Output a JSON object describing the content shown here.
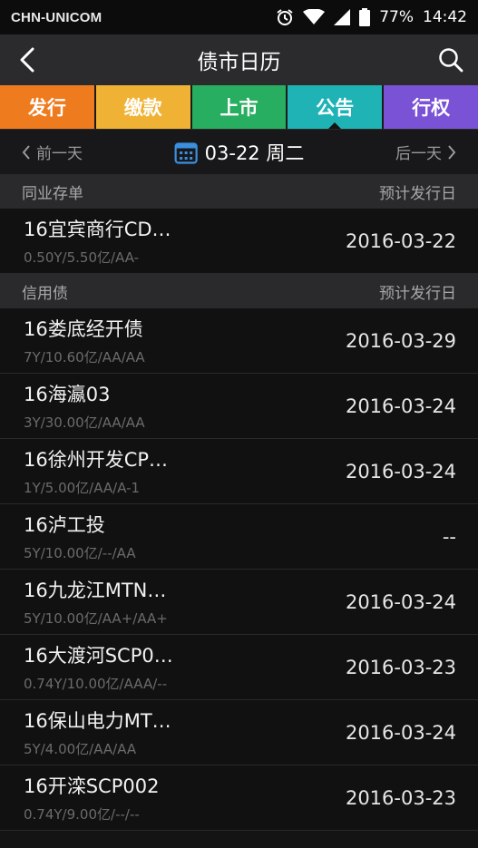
{
  "status_bar": {
    "carrier": "CHN-UNICOM",
    "battery": "77%",
    "time": "14:42"
  },
  "header": {
    "title": "债市日历",
    "back_icon": "chevron-left-icon",
    "search_icon": "search-icon"
  },
  "tabs": [
    {
      "label": "发行",
      "color": "#ef7b1f"
    },
    {
      "label": "缴款",
      "color": "#efb234"
    },
    {
      "label": "上市",
      "color": "#27ae60"
    },
    {
      "label": "公告",
      "color": "#1fb3b5",
      "active": true
    },
    {
      "label": "行权",
      "color": "#7a52d6"
    }
  ],
  "date_nav": {
    "prev_label": "前一天",
    "current": "03-22 周二",
    "next_label": "后一天",
    "calendar_icon": "calendar-icon",
    "accent": "#3a8fe0"
  },
  "sections": [
    {
      "title": "同业存单",
      "right_label": "预计发行日",
      "items": [
        {
          "name": "16宜宾商行CD…",
          "meta": "0.50Y/5.50亿/AA-",
          "date": "2016-03-22"
        }
      ]
    },
    {
      "title": "信用债",
      "right_label": "预计发行日",
      "items": [
        {
          "name": "16娄底经开债",
          "meta": "7Y/10.60亿/AA/AA",
          "date": "2016-03-29"
        },
        {
          "name": "16海瀛03",
          "meta": "3Y/30.00亿/AA/AA",
          "date": "2016-03-24"
        },
        {
          "name": "16徐州开发CP…",
          "meta": "1Y/5.00亿/AA/A-1",
          "date": "2016-03-24"
        },
        {
          "name": "16泸工投",
          "meta": "5Y/10.00亿/--/AA",
          "date": "--"
        },
        {
          "name": "16九龙江MTN…",
          "meta": "5Y/10.00亿/AA+/AA+",
          "date": "2016-03-24"
        },
        {
          "name": "16大渡河SCP0…",
          "meta": "0.74Y/10.00亿/AAA/--",
          "date": "2016-03-23"
        },
        {
          "name": "16保山电力MT…",
          "meta": "5Y/4.00亿/AA/AA",
          "date": "2016-03-24"
        },
        {
          "name": "16开滦SCP002",
          "meta": "0.74Y/9.00亿/--/--",
          "date": "2016-03-23"
        }
      ]
    }
  ]
}
